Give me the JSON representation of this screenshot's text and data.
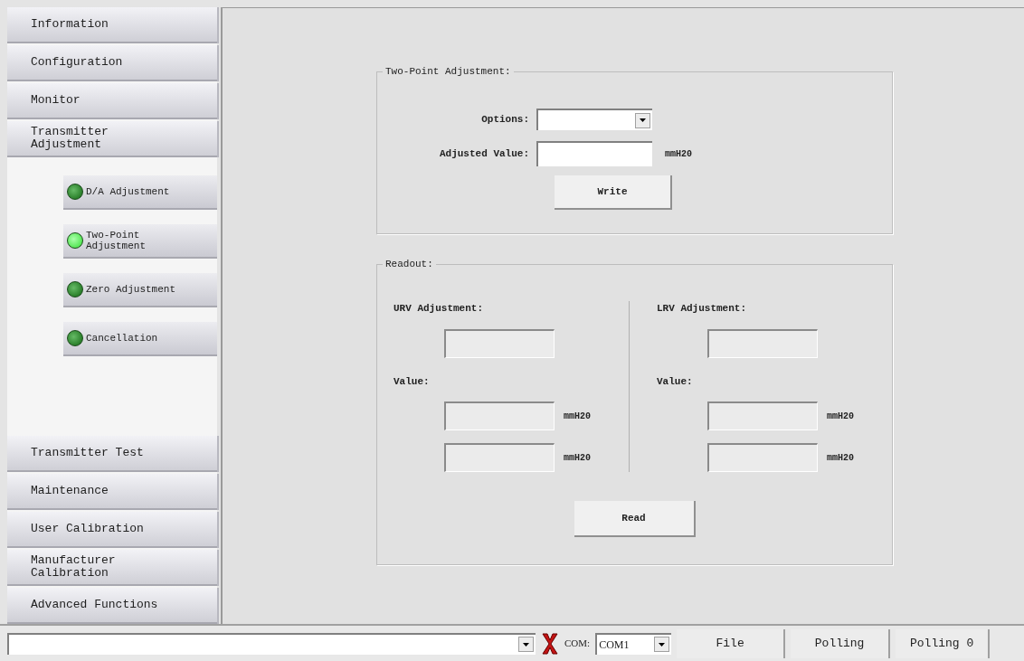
{
  "nav_items": [
    {
      "label": "Information"
    },
    {
      "label": "Configuration"
    },
    {
      "label": "Monitor"
    },
    {
      "label": "Transmitter\nAdjustment",
      "children": [
        {
          "label": "D/A Adjustment",
          "selected": false
        },
        {
          "label": "Two-Point\nAdjustment",
          "selected": true
        },
        {
          "label": "Zero Adjustment",
          "selected": false
        },
        {
          "label": "Cancellation",
          "selected": false
        }
      ]
    },
    {
      "label": "Transmitter Test"
    },
    {
      "label": "Maintenance"
    },
    {
      "label": "User Calibration"
    },
    {
      "label": "Manufacturer\nCalibration"
    },
    {
      "label": "Advanced Functions"
    }
  ],
  "two_point": {
    "title": "Two-Point Adjustment:",
    "options_label": "Options:",
    "adjusted_label": "Adjusted Value:",
    "unit": "mmH20",
    "write_button": "Write"
  },
  "readout": {
    "title": "Readout:",
    "columns": [
      {
        "heading": "URV Adjustment:",
        "value_label": "Value:",
        "units": [
          "mmH20",
          "mmH20"
        ]
      },
      {
        "heading": "LRV Adjustment:",
        "value_label": "Value:",
        "units": [
          "mmH20",
          "mmH20"
        ]
      }
    ],
    "read_button": "Read"
  },
  "status_bar": {
    "com_label": "COM:",
    "com_value": "COM1",
    "buttons": [
      "File",
      "Polling",
      "Polling 0"
    ]
  }
}
